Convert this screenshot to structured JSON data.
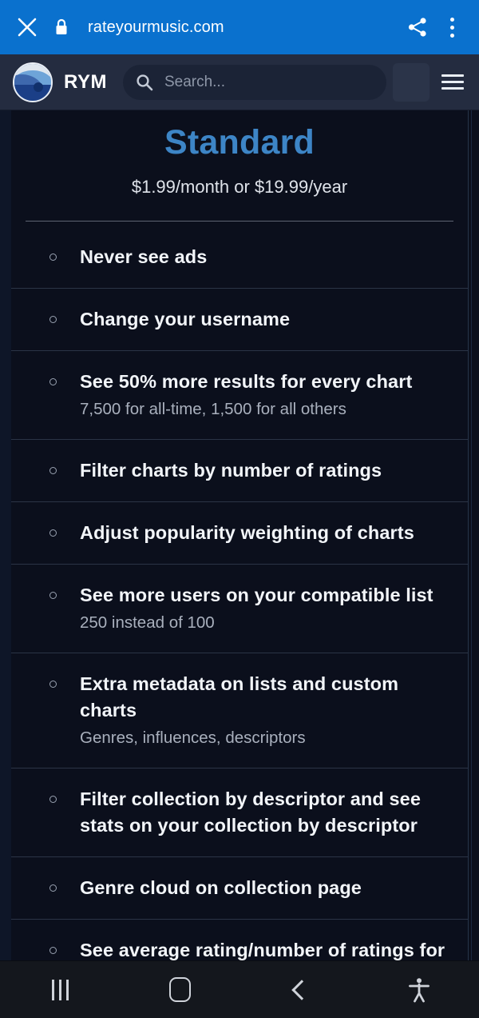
{
  "browser": {
    "close_icon": "close-icon",
    "lock_icon": "lock-icon",
    "url": "rateyourmusic.com",
    "share_icon": "share-icon",
    "overflow_icon": "more-vertical-icon",
    "bar_color": "#0a71ce"
  },
  "site_header": {
    "logo_icon": "rym-logo-icon",
    "brand": "RYM",
    "search": {
      "placeholder": "Search...",
      "value": "",
      "icon": "search-icon"
    },
    "menu_icon": "hamburger-menu-icon",
    "bg_color": "#242c40"
  },
  "plan": {
    "title": "Standard",
    "title_color": "#3d85c6",
    "price": "$1.99/month or $19.99/year",
    "features": [
      {
        "title": "Never see ads",
        "sub": ""
      },
      {
        "title": "Change your username",
        "sub": ""
      },
      {
        "title": "See 50% more results for every chart",
        "sub": "7,500 for all-time, 1,500 for all others"
      },
      {
        "title": "Filter charts by number of ratings",
        "sub": ""
      },
      {
        "title": "Adjust popularity weighting of charts",
        "sub": ""
      },
      {
        "title": "See more users on your compatible list",
        "sub": "250 instead of 100"
      },
      {
        "title": "Extra metadata on lists and custom charts",
        "sub": "Genres, influences, descriptors"
      },
      {
        "title": "Filter collection by descriptor and see stats on your collection by descriptor",
        "sub": ""
      },
      {
        "title": "Genre cloud on collection page",
        "sub": ""
      },
      {
        "title": "See average rating/number of ratings for tracks",
        "sub": ""
      }
    ]
  },
  "navbar": {
    "recents_icon": "recents-icon",
    "home_icon": "home-icon",
    "back_icon": "back-icon",
    "accessibility_icon": "accessibility-icon"
  }
}
